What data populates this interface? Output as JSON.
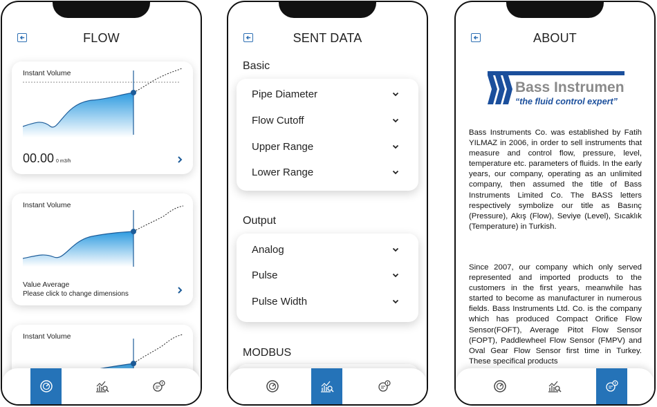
{
  "screens": {
    "flow": {
      "title": "FLOW",
      "cards": [
        {
          "label": "Instant Volume",
          "value": "00.00",
          "unit": "0 m3/h"
        },
        {
          "label": "Instant Volume",
          "sub1": "Value Average",
          "sub2": "Please click to change dimensions"
        },
        {
          "label": "Instant Volume"
        }
      ]
    },
    "sent": {
      "title": "SENT DATA",
      "sections": [
        {
          "title": "Basic",
          "items": [
            "Pipe Diameter",
            "Flow Cutoff",
            "Upper Range",
            "Lower Range"
          ]
        },
        {
          "title": "Output",
          "items": [
            "Analog",
            "Pulse",
            "Pulse Width"
          ]
        },
        {
          "title": "MODBUS"
        }
      ]
    },
    "about": {
      "title": "ABOUT",
      "logo_name": "Bass Instruments",
      "logo_tagline": "“the fluid control expert”",
      "paragraphs": [
        "Bass Instruments Co. was established by Fatih YILMAZ in 2006, in order to sell instruments that measure and control flow, pressure, level, temperature etc. parameters of fluids. In the early years, our company, operating as an unlimited company, then assumed the title of Bass Instruments Limited Co. The BASS letters respectively symbolize our title as Basınç (Pressure), Akış (Flow), Seviye (Level), Sıcaklık (Temperature) in Turkish.",
        "Since 2007, our company which only served represented and imported products to the customers in the first years, meanwhile has started to become as manufacturer in numerous fields. Bass Instruments Ltd. Co. is the company which has produced Compact Orifice Flow Sensor(FOFT), Average Pitot Flow Sensor (FOPT), Paddlewheel Flow Sensor (FMPV) and Oval Gear Flow Sensor first time in Turkey. These specifical products"
      ]
    }
  },
  "nav_icons": [
    "gauge-icon",
    "chart-search-icon",
    "info-bubble-icon"
  ],
  "colors": {
    "accent": "#2573b8",
    "chart_fill": "#3aa3e0",
    "chart_line": "#1d5c99"
  }
}
